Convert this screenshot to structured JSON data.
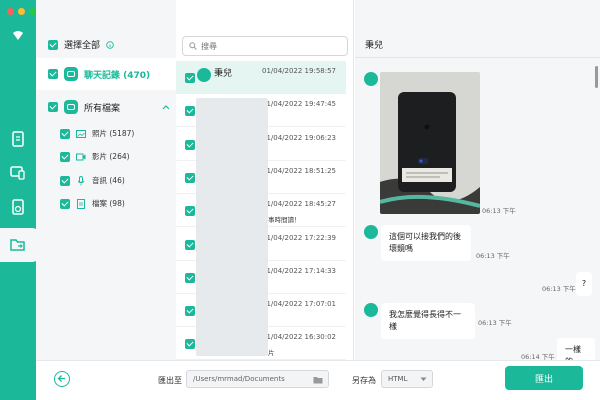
{
  "colors": {
    "accent": "#1bb99a",
    "rail": "#1bb99a",
    "panel": "#f5f6f8"
  },
  "categories": {
    "select_all": "選擇全部",
    "chat_records": "聊天記錄 (470)",
    "all_files": "所有檔案",
    "sub": [
      {
        "label": "照片 (5187)",
        "icon": "image-icon"
      },
      {
        "label": "影片 (264)",
        "icon": "video-icon"
      },
      {
        "label": "音訊 (46)",
        "icon": "microphone-icon"
      },
      {
        "label": "檔案 (98)",
        "icon": "document-icon"
      }
    ]
  },
  "search": {
    "placeholder": "搜尋"
  },
  "list": {
    "rows": [
      {
        "name": "秉兒",
        "date": "01/04/2022 19:58:57",
        "snippet": ""
      },
      {
        "name": "",
        "date": "01/04/2022 19:47:45",
        "snippet": ""
      },
      {
        "name": "",
        "date": "01/04/2022 19:06:23",
        "snippet": ""
      },
      {
        "name": "",
        "date": "01/04/2022 18:51:25",
        "snippet": ""
      },
      {
        "name": "",
        "date": "01/04/2022 18:45:27",
        "snippet": "事時間讀！"
      },
      {
        "name": "",
        "date": "01/04/2022 17:22:39",
        "snippet": ""
      },
      {
        "name": "",
        "date": "01/04/2022 17:14:33",
        "snippet": ""
      },
      {
        "name": "",
        "date": "01/04/2022 17:07:01",
        "snippet": ""
      },
      {
        "name": "",
        "date": "01/04/2022 16:30:02",
        "snippet": "片"
      }
    ]
  },
  "chat": {
    "title": "秉兒",
    "ts1": "06:13 下午",
    "msg1": "這個可以接我們的後壞鏡嗎",
    "ts2": "06:13 下午",
    "msg2": "?",
    "ts3": "06:13 下午",
    "msg3": "我怎麼覺得長得不一樣",
    "ts4": "06:13 下午",
    "msg4": "一樣的",
    "ts5": "06:14 下午"
  },
  "footer": {
    "export_to": "匯出至",
    "path": "/Users/mrmad/Documents",
    "save_as": "另存為",
    "format": "HTML",
    "export_button": "匯出"
  }
}
